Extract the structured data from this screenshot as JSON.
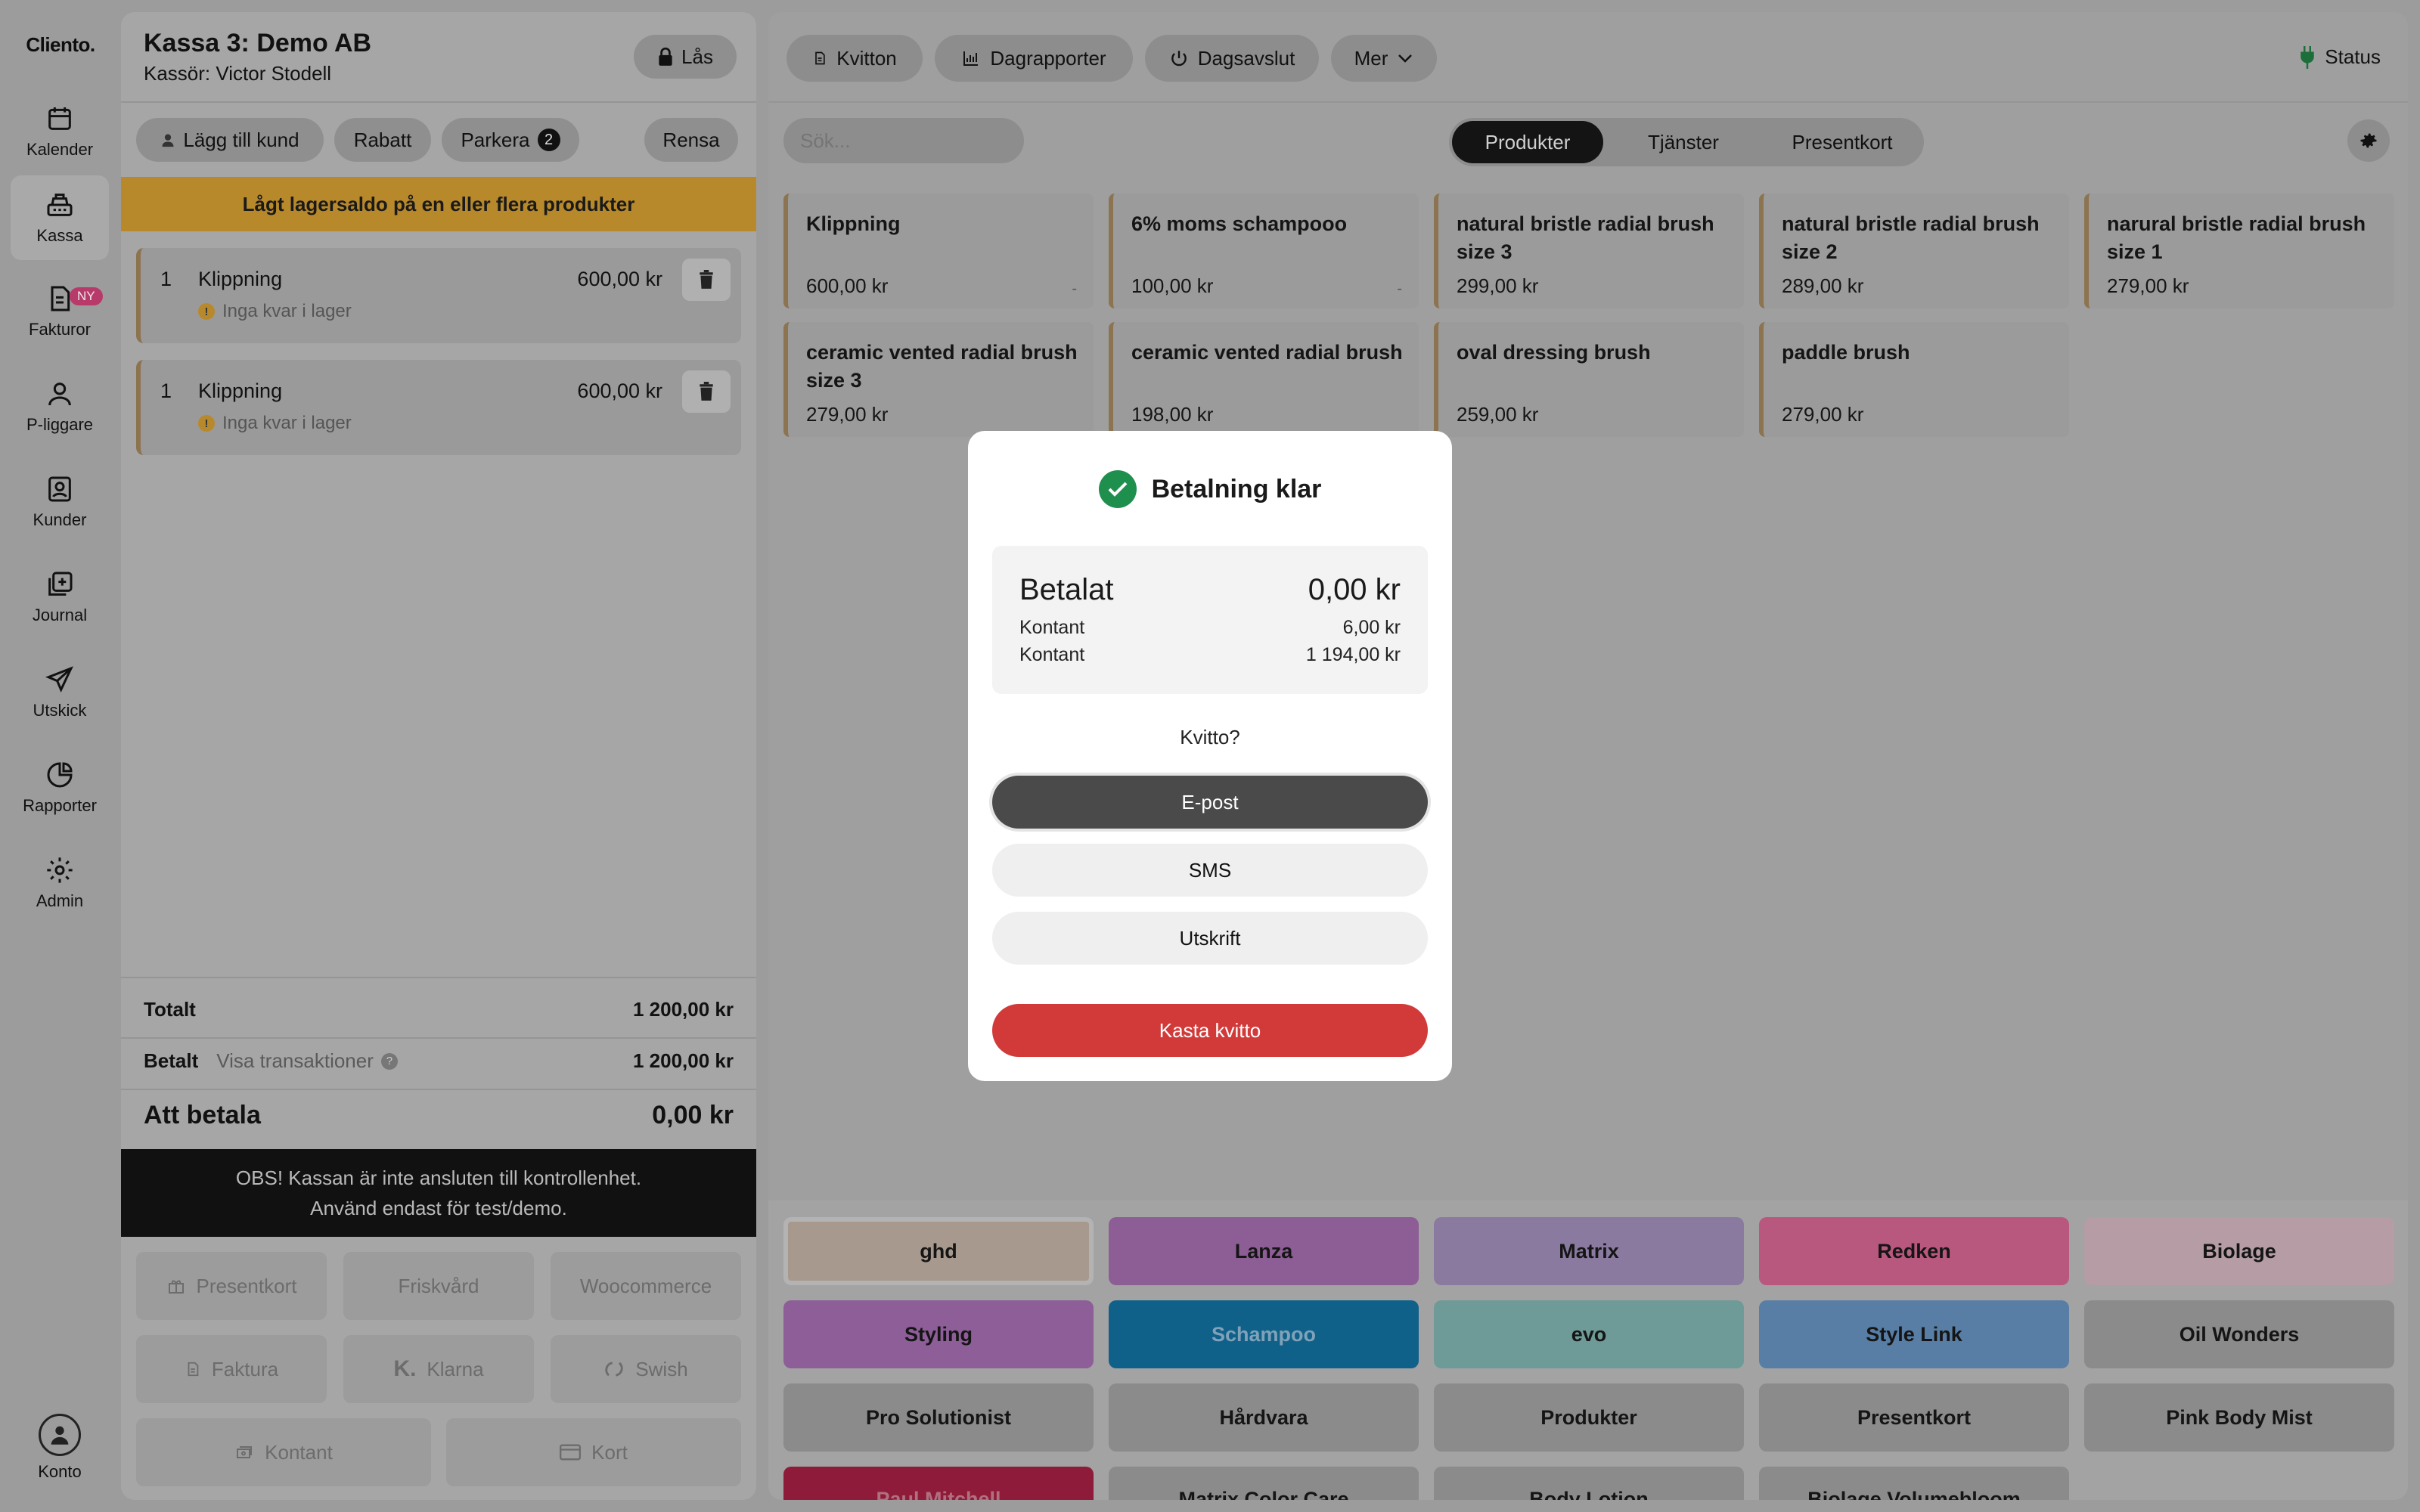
{
  "nav": {
    "logo": "Cliento.",
    "items": [
      {
        "label": "Kalender",
        "icon": "calendar-icon"
      },
      {
        "label": "Kassa",
        "icon": "register-icon"
      },
      {
        "label": "Fakturor",
        "icon": "invoice-icon",
        "badge": "NY"
      },
      {
        "label": "P-liggare",
        "icon": "person-icon"
      },
      {
        "label": "Kunder",
        "icon": "contacts-icon"
      },
      {
        "label": "Journal",
        "icon": "journal-icon"
      },
      {
        "label": "Utskick",
        "icon": "send-icon"
      },
      {
        "label": "Rapporter",
        "icon": "pie-chart-icon"
      },
      {
        "label": "Admin",
        "icon": "gear-icon"
      }
    ],
    "account": "Konto"
  },
  "cart": {
    "title": "Kassa 3: Demo AB",
    "cashier": "Kassör: Victor Stodell",
    "lock": "Lås",
    "actions": {
      "add_customer": "Lägg till kund",
      "discount": "Rabatt",
      "park": "Parkera",
      "park_count": "2",
      "clear": "Rensa"
    },
    "warning": "Lågt lagersaldo på en eller flera produkter",
    "lines": [
      {
        "qty": "1",
        "name": "Klippning",
        "price": "600,00 kr",
        "stock": "Inga kvar i lager"
      },
      {
        "qty": "1",
        "name": "Klippning",
        "price": "600,00 kr",
        "stock": "Inga kvar i lager"
      }
    ],
    "totals": {
      "total_label": "Totalt",
      "total": "1 200,00 kr",
      "paid_label": "Betalt",
      "show_tx": "Visa transaktioner",
      "paid": "1 200,00 kr",
      "due_label": "Att betala",
      "due": "0,00 kr"
    },
    "notice_line1": "OBS! Kassan är inte ansluten till kontrollenhet.",
    "notice_line2": "Använd endast för test/demo.",
    "payments": {
      "gift": "Presentkort",
      "wellness": "Friskvård",
      "woo": "Woocommerce",
      "invoice": "Faktura",
      "klarna": "Klarna",
      "swish": "Swish",
      "cash": "Kontant",
      "card": "Kort"
    }
  },
  "toolbar": {
    "receipts": "Kvitton",
    "daily": "Dagrapporter",
    "close": "Dagsavslut",
    "more": "Mer",
    "status": "Status"
  },
  "search": {
    "placeholder": "Sök..."
  },
  "tabs": {
    "products": "Produkter",
    "services": "Tjänster",
    "gift": "Presentkort"
  },
  "products": [
    {
      "name": "Klippning",
      "price": "600,00 kr",
      "mark": "-"
    },
    {
      "name": "6% moms schampooo",
      "price": "100,00 kr",
      "mark": "-"
    },
    {
      "name": "natural bristle radial brush size 3",
      "price": "299,00 kr"
    },
    {
      "name": "natural bristle radial brush size 2",
      "price": "289,00 kr"
    },
    {
      "name": "narural bristle radial brush size 1",
      "price": "279,00 kr"
    },
    {
      "name": "ceramic vented radial brush size 3",
      "price": "279,00 kr"
    },
    {
      "name": "ceramic vented radial brush",
      "price": "198,00 kr"
    },
    {
      "name": "oval dressing brush",
      "price": "259,00 kr"
    },
    {
      "name": "paddle brush",
      "price": "279,00 kr"
    }
  ],
  "categories": [
    {
      "label": "ghd",
      "color": "#a7998d"
    },
    {
      "label": "Lanza",
      "color": "#8d5d95"
    },
    {
      "label": "Matrix",
      "color": "#8a7aa0"
    },
    {
      "label": "Redken",
      "color": "#b9587e"
    },
    {
      "label": "Biolage",
      "color": "#b59ca5"
    },
    {
      "label": "Styling",
      "color": "#8d5e98"
    },
    {
      "label": "Schampoo",
      "color": "#10618a"
    },
    {
      "label": "evo",
      "color": "#6e9a97"
    },
    {
      "label": "Style Link",
      "color": "#587ea6"
    },
    {
      "label": "Oil Wonders",
      "color": "#8b8b8b"
    },
    {
      "label": "Pro Solutionist",
      "color": "#8b8b8b"
    },
    {
      "label": "Hårdvara",
      "color": "#8b8b8b"
    },
    {
      "label": "Produkter",
      "color": "#8b8b8b"
    },
    {
      "label": "Presentkort",
      "color": "#8b8b8b"
    },
    {
      "label": "Pink Body Mist",
      "color": "#8b8b8b"
    },
    {
      "label": "Paul Mitchell",
      "color": "#8e1b3a"
    },
    {
      "label": "Matrix Color Care",
      "color": "#8b8b8b"
    },
    {
      "label": "Body Lotion",
      "color": "#8b8b8b"
    },
    {
      "label": "Biolage Volumebloom",
      "color": "#8b8b8b"
    }
  ],
  "modal": {
    "title": "Betalning klar",
    "paid_label": "Betalat",
    "paid_value": "0,00 kr",
    "tx": [
      {
        "label": "Kontant",
        "value": "6,00 kr"
      },
      {
        "label": "Kontant",
        "value": "1 194,00 kr"
      }
    ],
    "question": "Kvitto?",
    "email": "E-post",
    "sms": "SMS",
    "print": "Utskrift",
    "discard": "Kasta kvitto"
  }
}
